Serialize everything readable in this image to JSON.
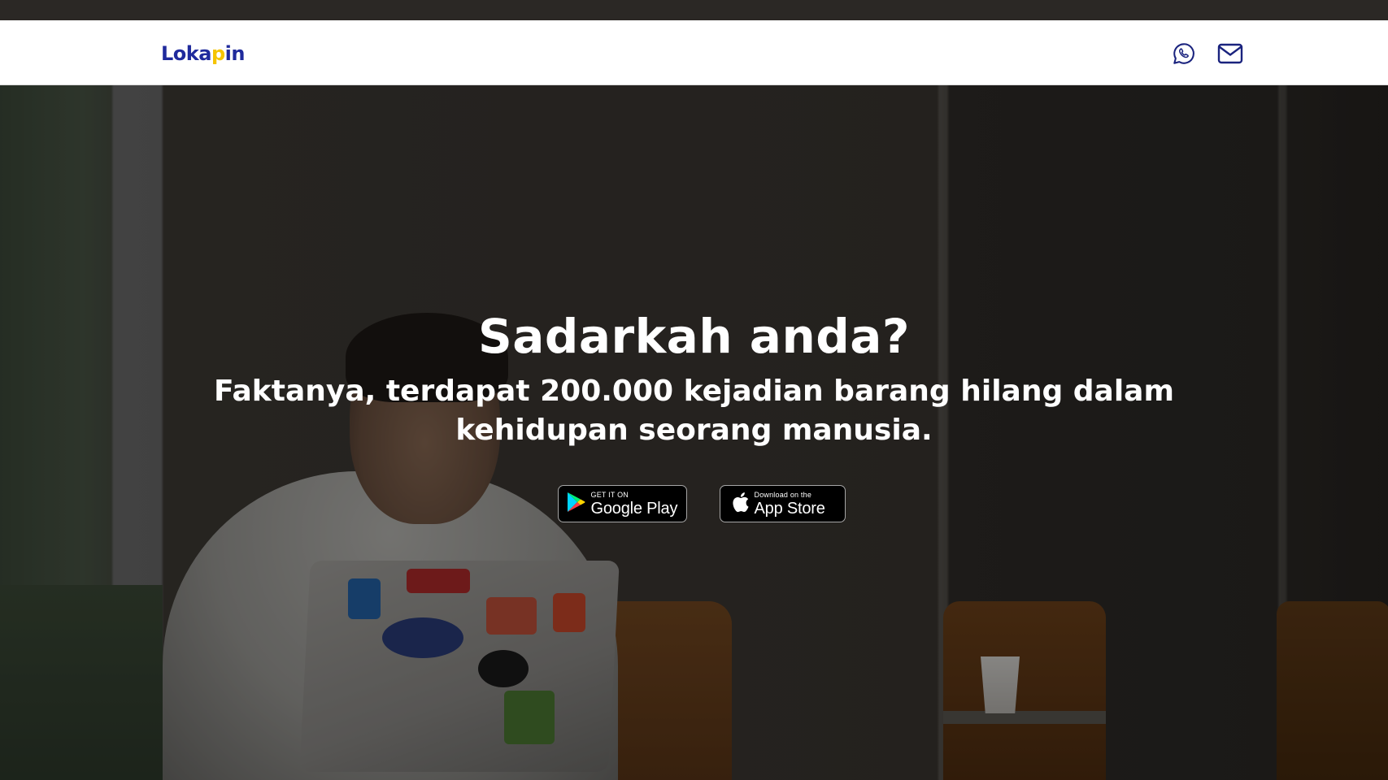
{
  "navbar": {
    "logo": {
      "part1": "Loka",
      "part2": "p",
      "part3": "in"
    },
    "icons": [
      "whatsapp-icon",
      "mail-icon"
    ]
  },
  "hero": {
    "title": "Sadarkah anda?",
    "subtitle": "Faktanya, terdapat 200.000 kejadian barang hilang dalam kehidupan seorang manusia."
  },
  "stores": {
    "google_play": {
      "small": "GET IT ON",
      "big": "Google Play"
    },
    "app_store": {
      "small": "Download on the",
      "big": "App Store"
    }
  },
  "colors": {
    "brand_blue": "#1f2a9c",
    "brand_yellow": "#f5c400",
    "icon_blue": "#1a237e"
  }
}
